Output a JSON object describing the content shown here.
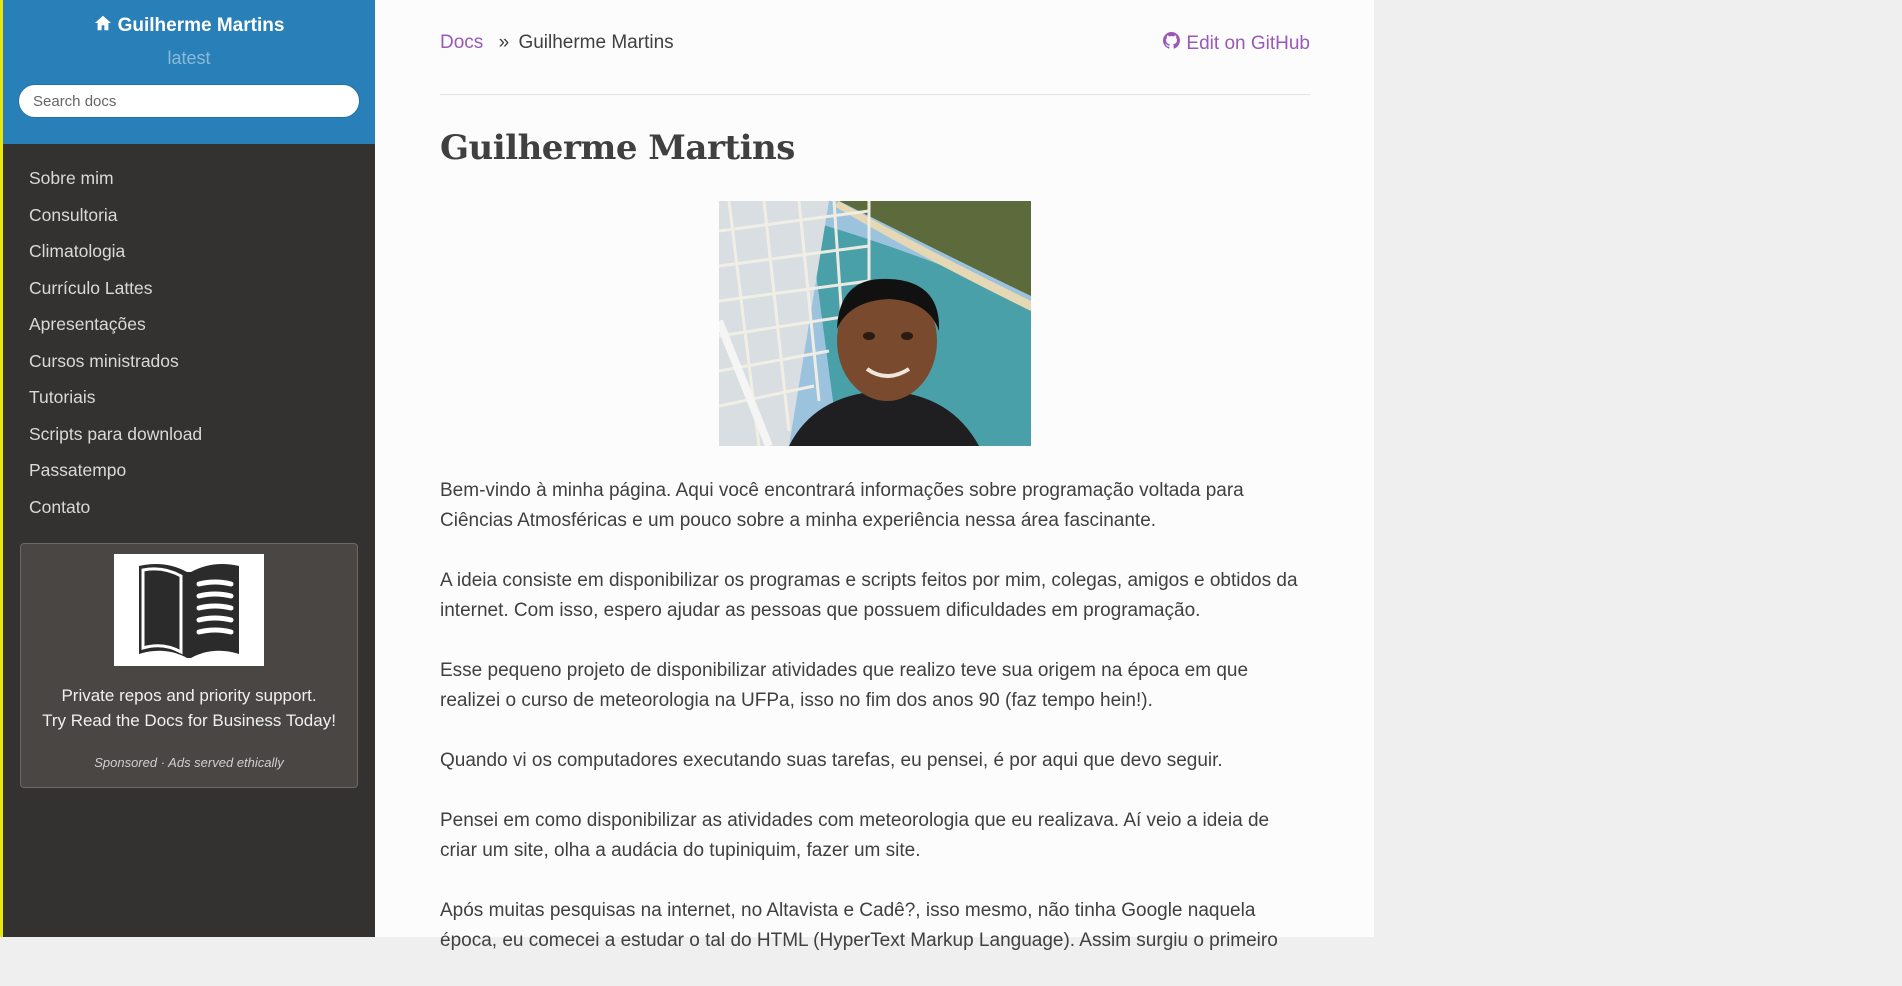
{
  "sidebar": {
    "brand": "Guilherme Martins",
    "brand_icon": "home-icon",
    "version": "latest",
    "search_placeholder": "Search docs",
    "nav_items": [
      "Sobre mim",
      "Consultoria",
      "Climatologia",
      "Currículo Lattes",
      "Apresentações",
      "Cursos ministrados",
      "Tutoriais",
      "Scripts para download",
      "Passatempo",
      "Contato"
    ],
    "ad": {
      "line1": "Private repos and priority support.",
      "line2": "Try Read the Docs for Business Today!",
      "sponsor": "Sponsored · Ads served ethically"
    }
  },
  "breadcrumb": {
    "docs": "Docs",
    "separator": "»",
    "current": "Guilherme Martins",
    "edit_label": "Edit on GitHub",
    "edit_icon": "github-icon"
  },
  "page": {
    "title": "Guilherme Martins",
    "paragraphs": [
      "Bem-vindo à minha página. Aqui você encontrará informações sobre programação voltada para Ciências Atmosféricas e um pouco sobre a minha experiência nessa área fascinante.",
      "A ideia consiste em disponibilizar os programas e scripts feitos por mim, colegas, amigos e obtidos da internet. Com isso, espero ajudar as pessoas que possuem dificuldades em programação.",
      "Esse pequeno projeto de disponibilizar atividades que realizo teve sua origem na época em que realizei o curso de meteorologia na UFPa, isso no fim dos anos 90 (faz tempo hein!).",
      "Quando vi os computadores executando suas tarefas, eu pensei, é por aqui que devo seguir.",
      "Pensei em como disponibilizar as atividades com meteorologia que eu realizava. Aí veio a ideia de criar um site, olha a audácia do tupiniquim, fazer um site.",
      "Após muitas pesquisas na internet, no Altavista e Cadê?, isso mesmo, não tinha Google naquela época, eu comecei a estudar o tal do HTML (HyperText Markup Language). Assim surgiu o primeiro"
    ]
  },
  "colors": {
    "sidebar_top": "#2980b9",
    "sidebar_bg": "#343131",
    "link": "#9b59b6",
    "text": "#404040"
  }
}
